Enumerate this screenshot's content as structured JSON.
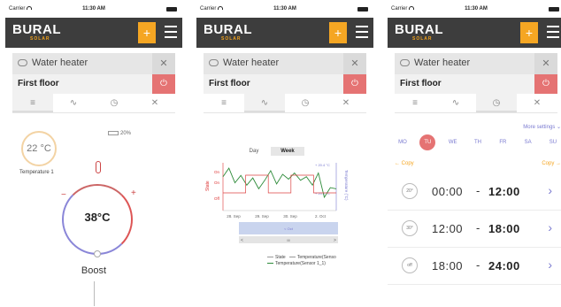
{
  "status": {
    "carrier": "Carrier",
    "time": "11:30 AM"
  },
  "brand": {
    "logo": "BURAL",
    "sub": "SOLAR",
    "plus": "+"
  },
  "device": {
    "name": "Water heater",
    "settings_glyph": "✕",
    "power_glyph": "⏻"
  },
  "floor": {
    "name": "First floor"
  },
  "tabs": [
    {
      "glyph": "≡",
      "name": "list"
    },
    {
      "glyph": "∿",
      "name": "chart"
    },
    {
      "glyph": "◷",
      "name": "schedule"
    },
    {
      "glyph": "✕",
      "name": "settings"
    }
  ],
  "panel1": {
    "temperature": "22 °C",
    "temperature_label": "Temperature 1",
    "battery": "20%",
    "minus": "−",
    "plus": "+",
    "setpoint": "38°C",
    "mode": "Boost"
  },
  "panel2": {
    "range_tabs": [
      "Day",
      "Week"
    ],
    "active_range": "Week",
    "nav_left": "<",
    "nav_mid": "III",
    "nav_right": ">",
    "legend": [
      {
        "label": "State",
        "color": "#999999"
      },
      {
        "label": "Temperature(Senso",
        "color": "#999999"
      },
      {
        "label": "Temperature(Sensor 1_1)",
        "color": "#2e8b3a"
      }
    ]
  },
  "chart_data": {
    "type": "line",
    "x": [
      "28. Sep",
      "29. Sep",
      "30. Sep",
      "2. Oct"
    ],
    "left_axis": {
      "label": "State",
      "ticks": [
        "On",
        "On",
        "Off"
      ]
    },
    "right_axis": {
      "label": "Temperature (°C)",
      "ticks": [
        "+ 20.4 °C",
        "+ 20.0 °C"
      ]
    },
    "series": [
      {
        "name": "Temperature(Sensor 1_1)",
        "color": "#2e8b3a",
        "values": [
          25,
          32,
          20,
          26,
          18,
          24,
          15,
          22,
          30,
          19,
          27,
          23,
          28,
          22,
          25,
          18,
          28,
          8,
          16,
          15
        ]
      },
      {
        "name": "State",
        "color": "#d44",
        "values": [
          0,
          1,
          0,
          1,
          0
        ]
      }
    ],
    "navigator_label": "< Oct",
    "grid": false
  },
  "panel3": {
    "more_settings": "More settings ⌄",
    "days": [
      "MO",
      "TU",
      "WE",
      "TH",
      "FR",
      "SA",
      "SU"
    ],
    "selected_day": "TU",
    "copy_left": "← Copy",
    "copy_right": "Copy →",
    "schedule": [
      {
        "temp": "20°",
        "from": "00:00",
        "to": "12:00"
      },
      {
        "temp": "30°",
        "from": "12:00",
        "to": "18:00"
      },
      {
        "temp": "off",
        "from": "18:00",
        "to": "24:00"
      }
    ],
    "dash": "-",
    "arrow": "›"
  },
  "colors": {
    "accent": "#f5a623",
    "appbar": "#3d3d3d",
    "danger": "#e57373",
    "link": "#7a7ad0"
  }
}
